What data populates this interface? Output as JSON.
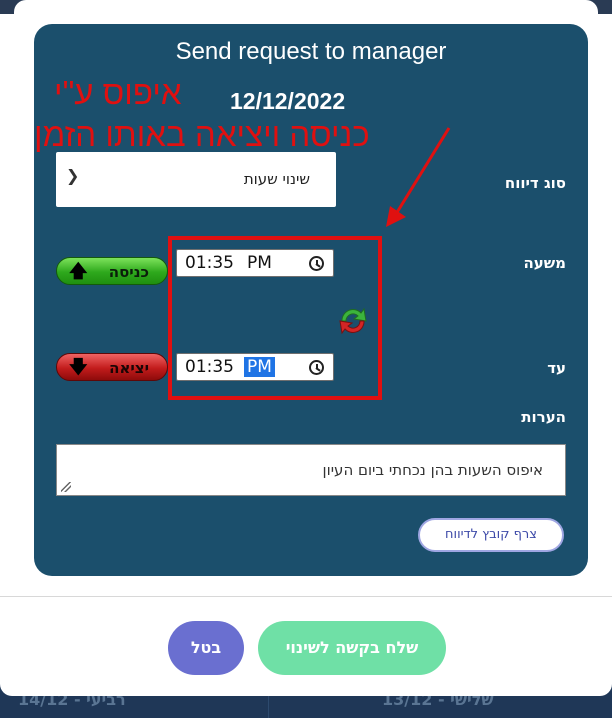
{
  "dialog": {
    "title": "Send request to manager",
    "date": "12/12/2022",
    "annotation_reset": "איפוס ע\"י",
    "annotation_same_time": "כניסה ויציאה באותו הזמן",
    "report_type": {
      "label": "סוג דיווח",
      "selected": "שינוי שעות"
    },
    "from": {
      "label": "משעה",
      "time": "01:35",
      "ampm": "PM"
    },
    "to": {
      "label": "עד",
      "time": "01:35",
      "ampm": "PM",
      "ampm_selected": true
    },
    "enter_button": "כניסה",
    "exit_button": "יציאה",
    "notes": {
      "label": "הערות",
      "value": "איפוס השעות בהן נכחתי ביום העיון"
    },
    "attach_file": "צרף קובץ לדיווח",
    "send": "שלח בקשה לשינוי",
    "cancel": "בטל"
  },
  "background_days": {
    "left": "רביעי - 14/12",
    "right": "שלישי - 13/12"
  },
  "colors": {
    "panel": "#1b4f6c",
    "annotation": "#e01010",
    "send": "#6fe0a6",
    "cancel": "#6a6fd0",
    "highlight": "#1f74e5"
  },
  "icons": {
    "dropdown": "chevron-down-icon",
    "clock": "clock-icon",
    "swap": "swap-arrows-icon",
    "enter": "arrow-up-icon",
    "exit": "arrow-down-icon"
  }
}
